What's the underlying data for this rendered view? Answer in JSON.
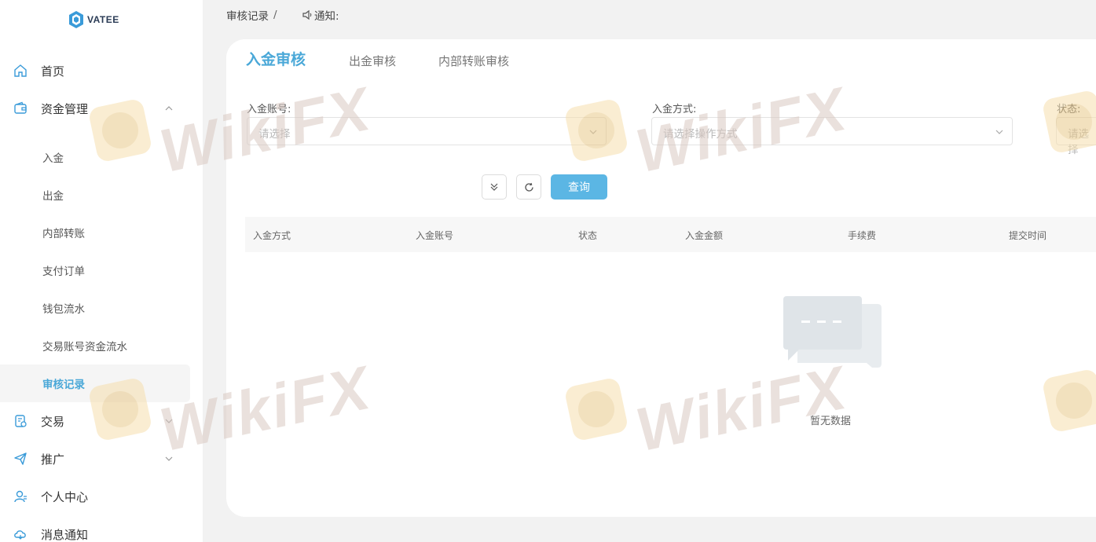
{
  "brand": {
    "logo_text": "VATEE"
  },
  "sidebar": {
    "items": [
      {
        "label": "首页",
        "icon": "home-icon"
      },
      {
        "label": "资金管理",
        "icon": "wallet-icon",
        "expanded": true
      },
      {
        "label": "交易",
        "icon": "trade-icon"
      },
      {
        "label": "推广",
        "icon": "send-icon"
      },
      {
        "label": "个人中心",
        "icon": "user-icon"
      },
      {
        "label": "消息通知",
        "icon": "cloud-icon"
      }
    ],
    "sub_items": [
      "入金",
      "出金",
      "内部转账",
      "支付订单",
      "钱包流水",
      "交易账号资金流水",
      "审核记录"
    ],
    "active_sub": "审核记录"
  },
  "header": {
    "breadcrumb": "审核记录",
    "breadcrumb_sep": "/",
    "notice_label": "通知:"
  },
  "tabs": [
    "入金审核",
    "出金审核",
    "内部转账审核"
  ],
  "filters": {
    "account_label": "入金账号:",
    "account_placeholder": "请选择",
    "method_label": "入金方式:",
    "method_placeholder": "请选择操作方式",
    "status_label": "状态:",
    "status_placeholder": "请选择"
  },
  "actions": {
    "query_label": "查询"
  },
  "table": {
    "columns": [
      "入金方式",
      "入金账号",
      "状态",
      "入金金额",
      "手续费",
      "提交时间"
    ],
    "rows": [],
    "empty_text": "暂无数据"
  },
  "watermark": "WikiFX",
  "colors": {
    "accent": "#5bb6e4",
    "active_text": "#4aa8d8"
  }
}
